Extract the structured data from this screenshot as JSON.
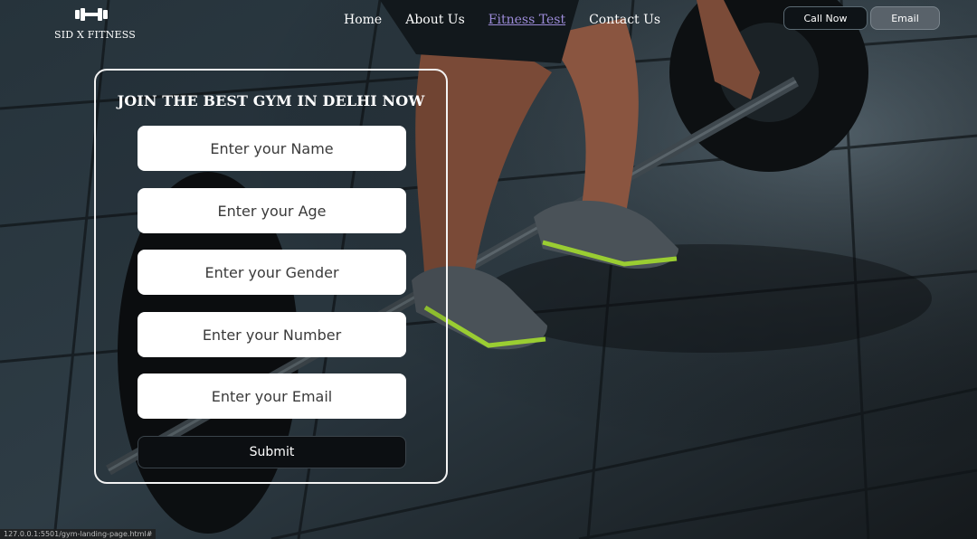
{
  "brand": {
    "name": "SID X FITNESS",
    "icon": "dumbbell-icon"
  },
  "nav": {
    "items": [
      "Home",
      "About Us",
      "Fitness Test",
      "Contact Us"
    ],
    "active": "Fitness Test"
  },
  "actions": {
    "call_label": "Call Now",
    "email_label": "Email"
  },
  "form": {
    "title": "JOIN THE BEST GYM IN DELHI NOW",
    "fields": [
      {
        "placeholder": "Enter your Name"
      },
      {
        "placeholder": "Enter your Age"
      },
      {
        "placeholder": "Enter your Gender"
      },
      {
        "placeholder": "Enter your Number"
      },
      {
        "placeholder": "Enter your Email"
      }
    ],
    "submit_label": "Submit"
  },
  "status_url": "127.0.0.1:5501/gym-landing-page.html#",
  "colors": {
    "active_link": "#9c8bd8",
    "accent_shoe": "#9acd32"
  }
}
